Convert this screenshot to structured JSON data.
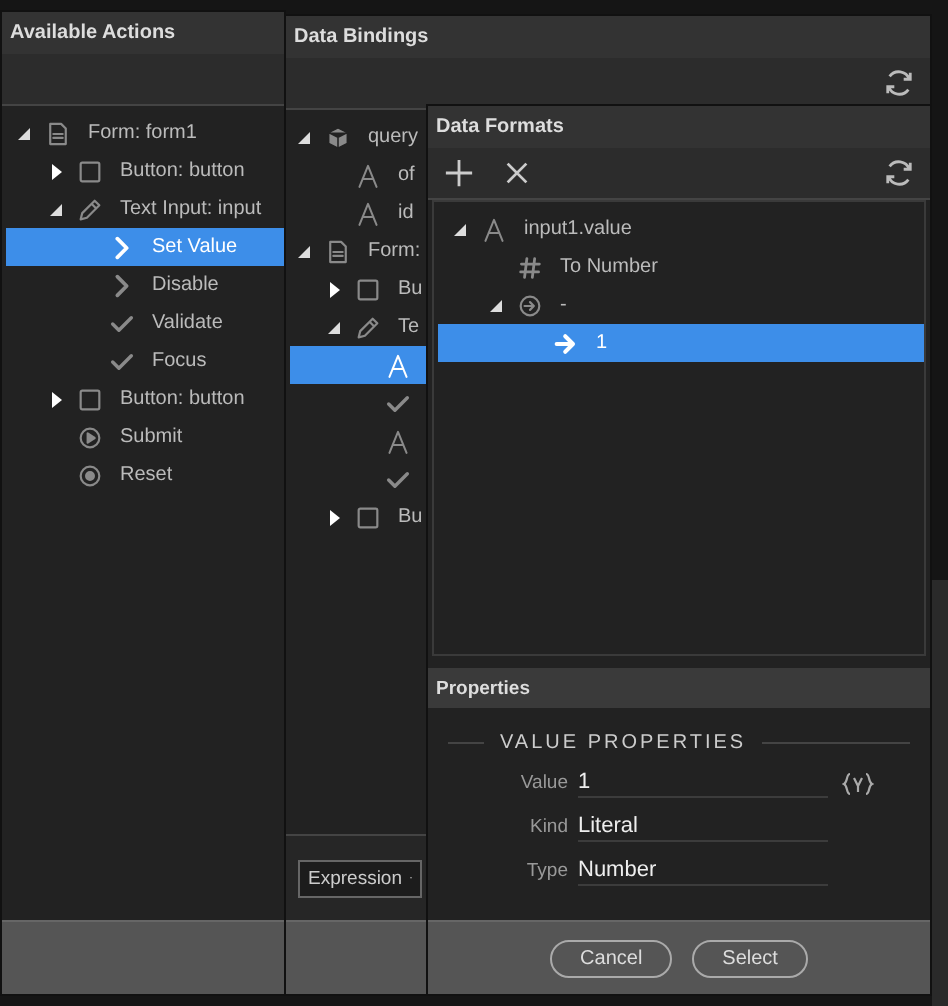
{
  "actions_panel": {
    "title": "Available Actions",
    "tree": [
      {
        "label": "Form: form1",
        "kind": "form",
        "expanded": true,
        "selected": false,
        "children": [
          {
            "label": "Button: button",
            "kind": "button",
            "expanded": false,
            "selected": false
          },
          {
            "label": "Text Input: input",
            "kind": "text-input",
            "expanded": true,
            "selected": false,
            "children": [
              {
                "label": "Set Value",
                "kind": "action",
                "selected": true
              },
              {
                "label": "Disable",
                "kind": "action",
                "selected": false
              },
              {
                "label": "Validate",
                "kind": "check",
                "selected": false
              },
              {
                "label": "Focus",
                "kind": "check",
                "selected": false
              }
            ]
          },
          {
            "label": "Button: button",
            "kind": "button",
            "expanded": false,
            "selected": false
          },
          {
            "label": "Submit",
            "kind": "submit",
            "selected": false
          },
          {
            "label": "Reset",
            "kind": "reset",
            "selected": false
          }
        ]
      }
    ]
  },
  "bindings_panel": {
    "title": "Data Bindings",
    "tree": [
      {
        "label": "query",
        "kind": "query",
        "expanded": true,
        "selected": false,
        "children": [
          {
            "label": "of",
            "kind": "text",
            "selected": false
          },
          {
            "label": "id",
            "kind": "text",
            "selected": false
          }
        ]
      },
      {
        "label": "Form:",
        "kind": "form",
        "expanded": true,
        "selected": false,
        "children": [
          {
            "label": "Bu",
            "kind": "button",
            "expanded": false,
            "selected": false
          },
          {
            "label": "Te",
            "kind": "text-input",
            "expanded": true,
            "selected": false,
            "children": [
              {
                "kind": "text",
                "selected": true
              },
              {
                "kind": "check",
                "selected": false
              },
              {
                "kind": "text",
                "selected": false
              },
              {
                "kind": "check",
                "selected": false
              }
            ]
          },
          {
            "label": "Bu",
            "kind": "button",
            "expanded": false,
            "selected": false
          }
        ]
      }
    ],
    "mode": "Expression"
  },
  "formats_panel": {
    "title": "Data Formats",
    "tree": [
      {
        "label": "input1.value",
        "kind": "text",
        "expanded": true,
        "selected": false,
        "children": [
          {
            "label": "To Number",
            "kind": "number",
            "selected": false
          },
          {
            "label": "-",
            "kind": "value",
            "expanded": true,
            "selected": false,
            "children": [
              {
                "label": "1",
                "kind": "literal",
                "selected": true
              }
            ]
          }
        ]
      }
    ],
    "properties": {
      "title": "Properties",
      "section": "VALUE PROPERTIES",
      "fields": [
        {
          "label": "Value",
          "value": "1",
          "bindable": true
        },
        {
          "label": "Kind",
          "value": "Literal",
          "bindable": false
        },
        {
          "label": "Type",
          "value": "Number",
          "bindable": false
        }
      ]
    },
    "buttons": [
      "Cancel",
      "Select"
    ]
  }
}
